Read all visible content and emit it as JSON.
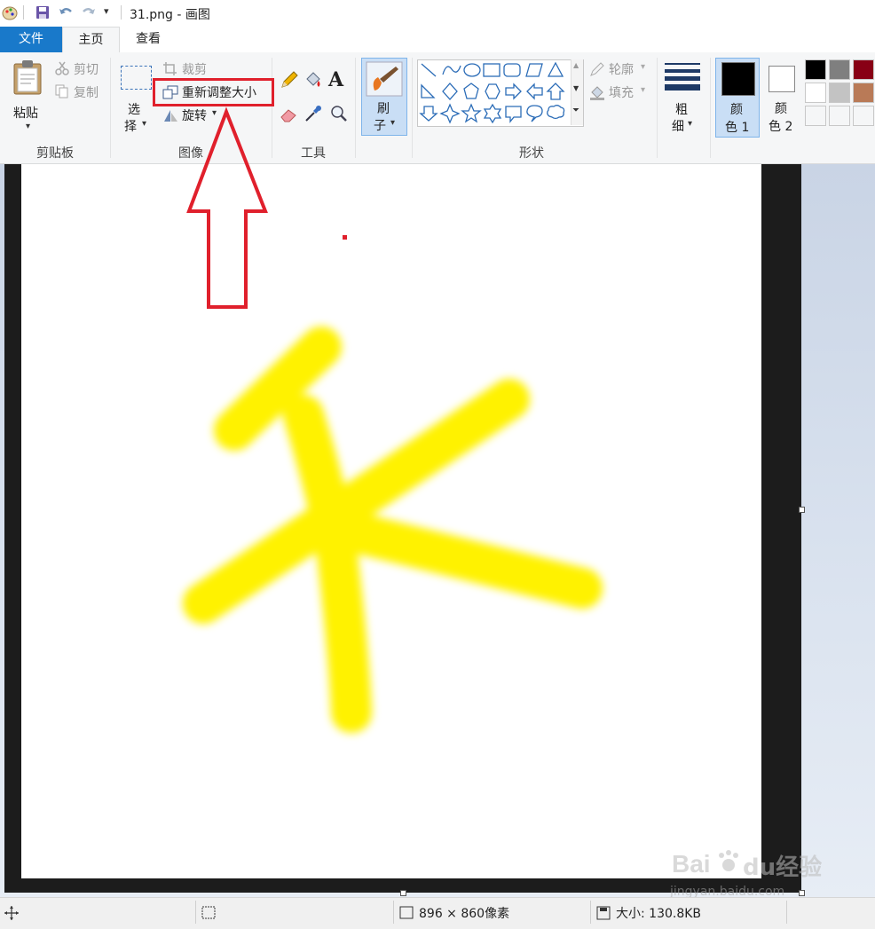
{
  "app": {
    "title": "31.png - 画图"
  },
  "tabs": [
    {
      "label": "文件"
    },
    {
      "label": "主页"
    },
    {
      "label": "查看"
    }
  ],
  "clipboard": {
    "paste_label": "粘贴",
    "cut_label": "剪切",
    "copy_label": "复制",
    "group_label": "剪贴板"
  },
  "image": {
    "select_label_1": "选",
    "select_label_2": "择",
    "crop_label": "裁剪",
    "resize_label": "重新调整大小",
    "rotate_label": "旋转",
    "group_label": "图像"
  },
  "tools": {
    "group_label": "工具"
  },
  "brush": {
    "label_1": "刷",
    "label_2": "子"
  },
  "shapes": {
    "outline_label": "轮廓",
    "fill_label": "填充",
    "group_label": "形状"
  },
  "size": {
    "label_1": "粗",
    "label_2": "细"
  },
  "colors": {
    "color1_label_1": "颜",
    "color1_label_2": "色 1",
    "color2_label_1": "颜",
    "color2_label_2": "色 2",
    "color1": "#000000",
    "color2": "#ffffff",
    "palette": [
      "#000000",
      "#7f7f7f",
      "#880015",
      "#ffffff",
      "#c3c3c3",
      "#b97a57",
      "#f5f6f7",
      "#f5f6f7",
      "#f5f6f7"
    ]
  },
  "status": {
    "dimensions": "896 × 860像素",
    "file_size": "大小: 130.8KB"
  },
  "watermark": {
    "logo_text": "Bai du 经验",
    "url": "jingyan.baidu.com"
  },
  "accent": {
    "highlight": "#e0202c",
    "brush_stroke": "#fff200",
    "file_tab": "#1979ca"
  }
}
